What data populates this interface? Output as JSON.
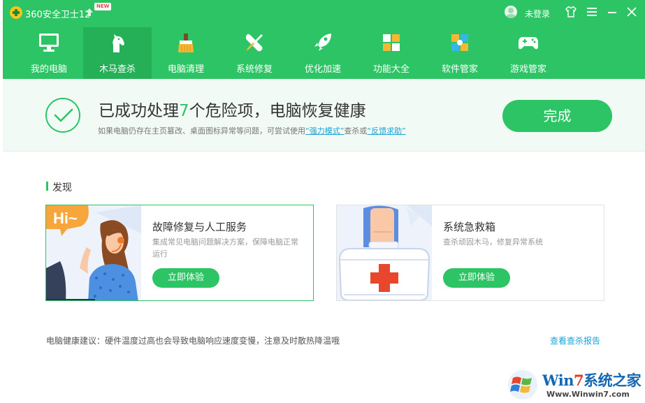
{
  "app": {
    "title": "360安全卫士12",
    "badge": "NEW",
    "login": "未登录"
  },
  "nav": {
    "items": [
      {
        "label": "我的电脑",
        "icon": "monitor-icon"
      },
      {
        "label": "木马查杀",
        "icon": "horse-icon",
        "active": true
      },
      {
        "label": "电脑清理",
        "icon": "broom-icon"
      },
      {
        "label": "系统修复",
        "icon": "wrench-screwdriver-icon"
      },
      {
        "label": "优化加速",
        "icon": "rocket-icon"
      },
      {
        "label": "功能大全",
        "icon": "grid-icon"
      },
      {
        "label": "软件管家",
        "icon": "apps-icon"
      },
      {
        "label": "游戏管家",
        "icon": "gamepad-icon"
      }
    ]
  },
  "result": {
    "title_prefix": "已成功处理",
    "count": "7",
    "title_suffix": "个危险项，电脑恢复健康",
    "sub_prefix": "如果电脑仍存在主页篡改、桌面图标异常等问题，可尝试使用",
    "link1": "“强力模式”",
    "sub_middle": "查杀或",
    "link2": "“反馈求助”",
    "done_button": "完成"
  },
  "discover": {
    "title": "发现",
    "cards": [
      {
        "title": "故障修复与人工服务",
        "desc": "集成常见电脑问题解决方案，保障电脑正常运行",
        "button": "立即体验",
        "image_text": "Hi~"
      },
      {
        "title": "系统急救箱",
        "desc": "查杀顽固木马，修复异常系统",
        "button": "立即体验"
      }
    ]
  },
  "footer": {
    "tip": "电脑健康建议：硬件温度过高也会导致电脑响应速度变慢，注意及时散热降温哦",
    "report_link": "查看查杀报告"
  },
  "watermark": {
    "title_a": "Win",
    "title_b": "7",
    "title_c": "系统之家",
    "url": "Www.Winwin7.com"
  },
  "colors": {
    "primary": "#2cc464",
    "active_tab": "#25b057",
    "link": "#1aa3d4"
  }
}
